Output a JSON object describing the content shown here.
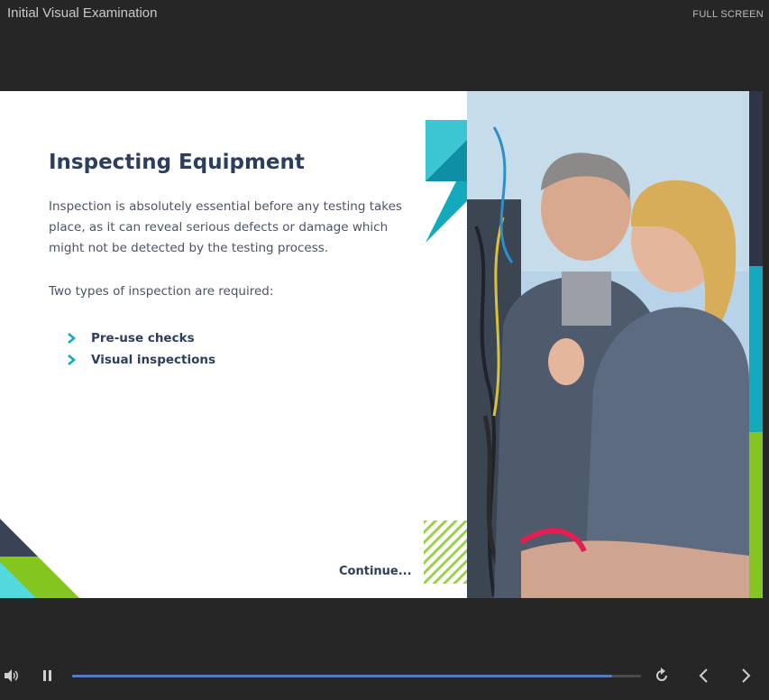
{
  "header": {
    "course_title": "Initial Visual Examination",
    "fullscreen_label": "FULL SCREEN"
  },
  "slide": {
    "title": "Inspecting Equipment",
    "intro": "Inspection is absolutely essential before any testing takes place, as it can reveal serious defects or damage which might not be detected by the testing process.",
    "prompt": "Two types of inspection are required:",
    "bullets": [
      "Pre-use checks",
      "Visual inspections"
    ],
    "continue_label": "Continue...",
    "photo_icon": "instructor-and-trainee-with-wiring-photo"
  },
  "player": {
    "volume_icon": "volume-icon",
    "play_state": "playing",
    "progress": 0.95,
    "replay_icon": "replay-icon",
    "prev_icon": "chevron-left-icon",
    "next_icon": "chevron-right-icon"
  },
  "colors": {
    "background": "#262626",
    "navy": "#2d3e5c",
    "teal": "#14a9bd",
    "light_teal": "#52d9de",
    "lime": "#84c51f",
    "progress": "#4f7fbf"
  }
}
